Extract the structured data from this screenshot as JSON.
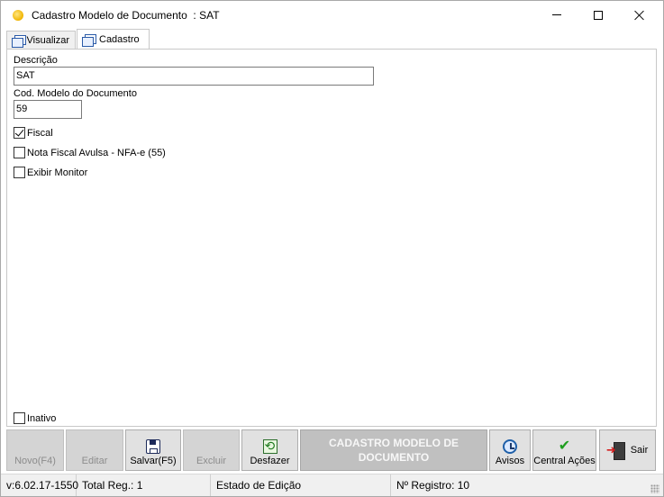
{
  "window": {
    "title": "Cadastro Modelo de Documento  : SAT"
  },
  "tabs": [
    {
      "label": "Visualizar",
      "active": false
    },
    {
      "label": "Cadastro",
      "active": true
    }
  ],
  "form": {
    "descricao_label": "Descrição",
    "descricao_value": "SAT",
    "cod_label": "Cod. Modelo do Documento",
    "cod_value": "59",
    "fiscal_label": "Fiscal",
    "fiscal_checked": true,
    "nfa_label": "Nota Fiscal Avulsa - NFA-e (55)",
    "nfa_checked": false,
    "monitor_label": "Exibir Monitor",
    "monitor_checked": false,
    "inativo_label": "Inativo",
    "inativo_checked": false
  },
  "toolbar": {
    "novo": "Novo(F4)",
    "editar": "Editar",
    "salvar": "Salvar(F5)",
    "excluir": "Excluir",
    "desfazer": "Desfazer",
    "banner": "CADASTRO MODELO DE DOCUMENTO",
    "avisos": "Avisos",
    "central": "Central Ações",
    "sair": "Sair"
  },
  "statusbar": {
    "version": "v:6.02.17-1550",
    "total": "Total Reg.: 1",
    "estado": "Estado de Edição",
    "registro": "Nº Registro: 10"
  },
  "colors": {
    "banner_bg": "#c0c0c0",
    "check_green": "#1f9e1f",
    "tab_icon_blue": "#2a5aa8"
  }
}
